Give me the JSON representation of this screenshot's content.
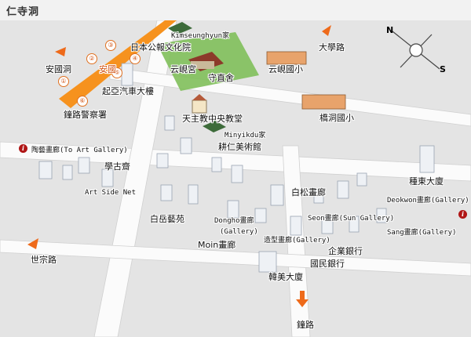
{
  "header": {
    "title": "仁寺洞"
  },
  "colors": {
    "road_main": "#f6921e",
    "road": "#ffffff",
    "park": "#7fbf5a",
    "arrow": "#ee6a1a"
  },
  "labels": {
    "kimseunghyun": "Kimseunghyun家",
    "japan_culture": "日本公報文化院",
    "daehak_ro": "大學路",
    "anguk_dong": "安國洞",
    "unhyeon_gung": "云峴宮",
    "sujikgsa": "守直舍",
    "unhyeon_school": "云峴國小",
    "kia_building": "起亞汽車大樓",
    "gyodong_school": "橋洞國小",
    "jongno_police": "鐘路警察署",
    "catholic_church": "天主教中央教堂",
    "minyikdu": "Minyikdu家",
    "gyeongin_museum": "耕仁美術館",
    "to_art_gallery": "陶藝畫廊(To Art Gallery)",
    "hakgojae": "學古齋",
    "art_side_net": "Art Side Net",
    "baeksong_gallery": "白松畫廊",
    "jongdong_building": "種東大廈",
    "deokwon_gallery": "Deokwon畫廊(Gallery)",
    "baekak_yewon": "白岳藝苑",
    "dongho_gallery_line1": "Dongho畫廊",
    "dongho_gallery_line2": "(Gallery)",
    "seon_gallery": "Seon畫廊(Sun Gallery)",
    "sang_gallery": "Sang畫廊(Gallery)",
    "moin_gallery": "Moin畫廊",
    "joheung_gallery": "造型畫廊(Gallery)",
    "gieop_bank": "企業銀行",
    "sejong_ro": "世宗路",
    "gukmin_bank": "國民銀行",
    "hanmi_building": "韓美大廈",
    "jong_ro": "鐘路",
    "anguk_station": "安國"
  },
  "markers": [
    "①",
    "②",
    "③",
    "④",
    "⑤",
    "⑥"
  ],
  "compass": {
    "north": "N",
    "south": "S"
  }
}
